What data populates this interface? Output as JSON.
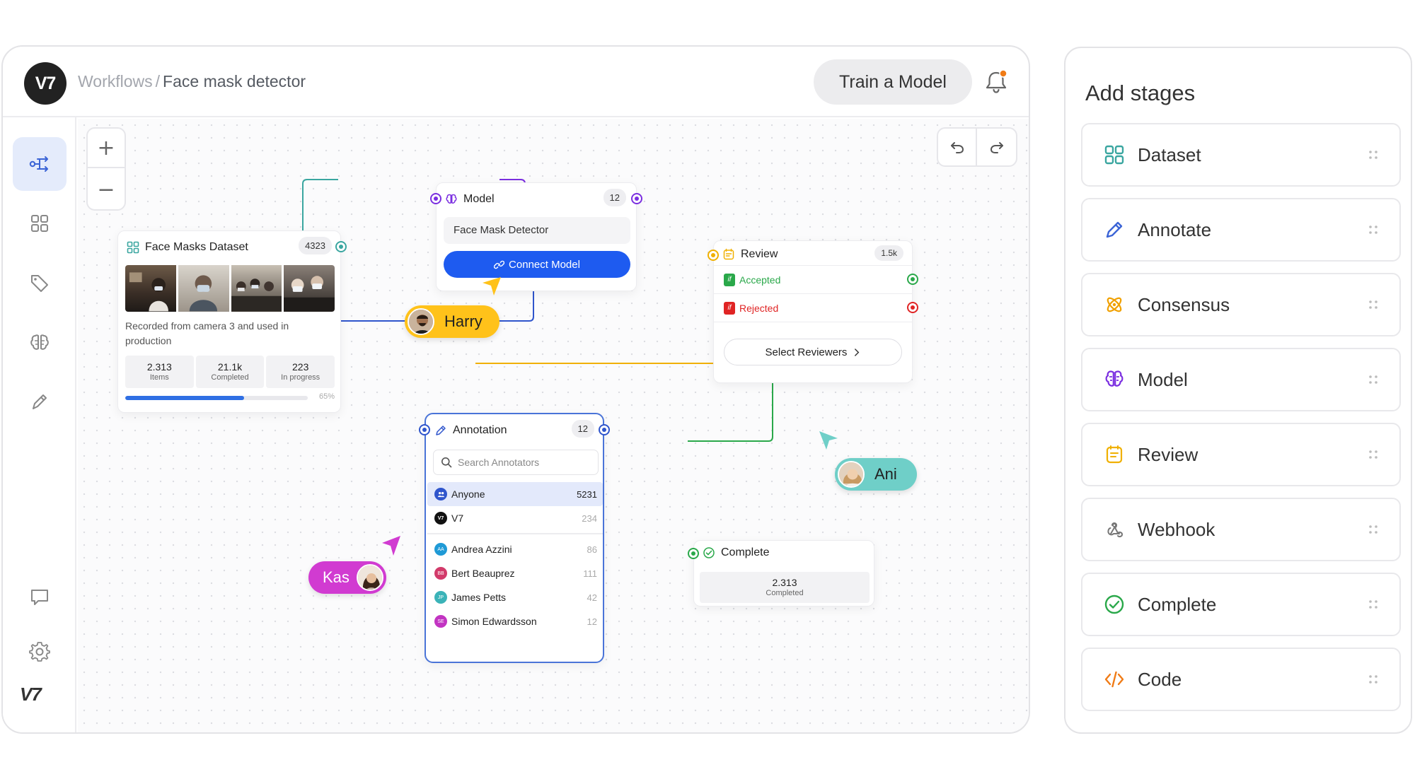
{
  "header": {
    "breadcrumb_parent": "Workflows",
    "breadcrumb_sep": "/",
    "breadcrumb_current": "Face mask detector",
    "train_button": "Train a Model",
    "logo": "V7"
  },
  "sidebar": {
    "items": [
      "workflow-icon",
      "dataset-icon",
      "tag-icon",
      "model-icon",
      "pen-icon",
      "chat-icon",
      "gear-icon"
    ],
    "footer_logo": "V7"
  },
  "canvas": {
    "zoom_in": "+",
    "zoom_out": "−"
  },
  "dataset_node": {
    "title": "Face Masks Dataset",
    "count": "4323",
    "description": "Recorded from camera 3 and used in production",
    "stats": [
      {
        "value": "2.313",
        "label": "Items"
      },
      {
        "value": "21.1k",
        "label": "Completed"
      },
      {
        "value": "223",
        "label": "In progress"
      }
    ],
    "progress_percent": 65,
    "progress_label": "65%"
  },
  "model_node": {
    "title": "Model",
    "count": "12",
    "model_name": "Face Mask Detector",
    "connect_button": "Connect Model"
  },
  "review_node": {
    "title": "Review",
    "count": "1.5k",
    "accepted": "Accepted",
    "rejected": "Rejected",
    "if_label": "if",
    "reviewers_button": "Select Reviewers"
  },
  "annotation_node": {
    "title": "Annotation",
    "count": "12",
    "search_placeholder": "Search Annotators",
    "groups": [
      {
        "name": "Anyone",
        "count": "5231"
      },
      {
        "name": "V7",
        "count": "234"
      }
    ],
    "users": [
      {
        "name": "Andrea Azzini",
        "initials": "AA",
        "count": "86"
      },
      {
        "name": "Bert Beauprez",
        "initials": "BB",
        "count": "111"
      },
      {
        "name": "James Petts",
        "initials": "JP",
        "count": "42"
      },
      {
        "name": "Simon Edwardsson",
        "initials": "SE",
        "count": "12"
      }
    ]
  },
  "complete_node": {
    "title": "Complete",
    "value": "2.313",
    "label": "Completed"
  },
  "cursors": {
    "harry": "Harry",
    "ani": "Ani",
    "kas": "Kas"
  },
  "colors": {
    "primary": "#1e5bf0",
    "dataset": "#3aa6a0",
    "model": "#7b2fe0",
    "review": "#f0b000",
    "accepted": "#2aa84a",
    "rejected": "#e02424",
    "harry": "#ffc21a",
    "ani": "#6fcfc8",
    "kas": "#d13bd1"
  },
  "panel": {
    "title": "Add stages",
    "stages": [
      "Dataset",
      "Annotate",
      "Consensus",
      "Model",
      "Review",
      "Webhook",
      "Complete",
      "Code"
    ]
  }
}
